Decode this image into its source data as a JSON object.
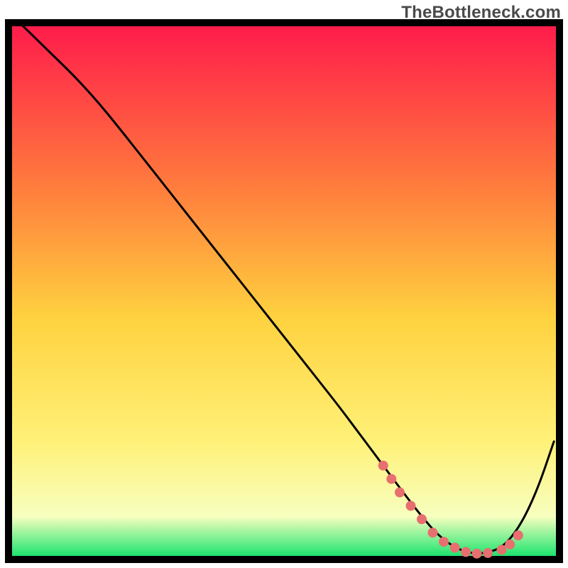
{
  "watermark": "TheBottleneck.com",
  "colors": {
    "curve": "#000000",
    "marker": "#e76f6f",
    "grad_top": "#ff1a4b",
    "grad_mid_upper": "#ff7a3d",
    "grad_mid": "#ffd23f",
    "grad_mid_lower": "#fff178",
    "grad_low": "#f7ffbf",
    "grad_bottom": "#08e267",
    "border": "#000000"
  },
  "chart_data": {
    "type": "line",
    "title": "",
    "xlabel": "",
    "ylabel": "",
    "xlim": [
      0,
      100
    ],
    "ylim": [
      0,
      100
    ],
    "legend": false,
    "grid": false,
    "series": [
      {
        "name": "bottleneck-curve",
        "style": "line",
        "color": "#000000",
        "x": [
          2,
          5,
          8,
          12,
          16,
          20,
          25,
          30,
          35,
          40,
          45,
          50,
          55,
          60,
          64,
          68,
          72,
          75,
          78,
          81,
          84,
          87,
          90,
          93,
          96,
          99
        ],
        "y": [
          100,
          97,
          94,
          90,
          85.5,
          80.5,
          74,
          67.5,
          61,
          54.5,
          48,
          41.5,
          35,
          28.5,
          23,
          17.5,
          12,
          8,
          4.5,
          2.2,
          1.1,
          1.2,
          2.5,
          6.5,
          13,
          22
        ]
      },
      {
        "name": "minimum-markers",
        "style": "points",
        "color": "#e76f6f",
        "x": [
          68,
          69.5,
          71,
          73,
          75,
          77,
          79,
          81,
          83,
          85,
          87,
          89.5,
          91,
          92.5
        ],
        "y": [
          17.5,
          15,
          12.5,
          10,
          7.5,
          5,
          3.3,
          2.2,
          1.4,
          1.1,
          1.2,
          1.8,
          2.8,
          4.5
        ]
      }
    ],
    "background_gradient": {
      "direction": "vertical",
      "stops": [
        {
          "offset": 0.0,
          "color": "#ff1a4b"
        },
        {
          "offset": 0.3,
          "color": "#ff7a3d"
        },
        {
          "offset": 0.55,
          "color": "#ffd23f"
        },
        {
          "offset": 0.78,
          "color": "#fff178"
        },
        {
          "offset": 0.92,
          "color": "#f7ffbf"
        },
        {
          "offset": 1.0,
          "color": "#08e267"
        }
      ]
    }
  }
}
